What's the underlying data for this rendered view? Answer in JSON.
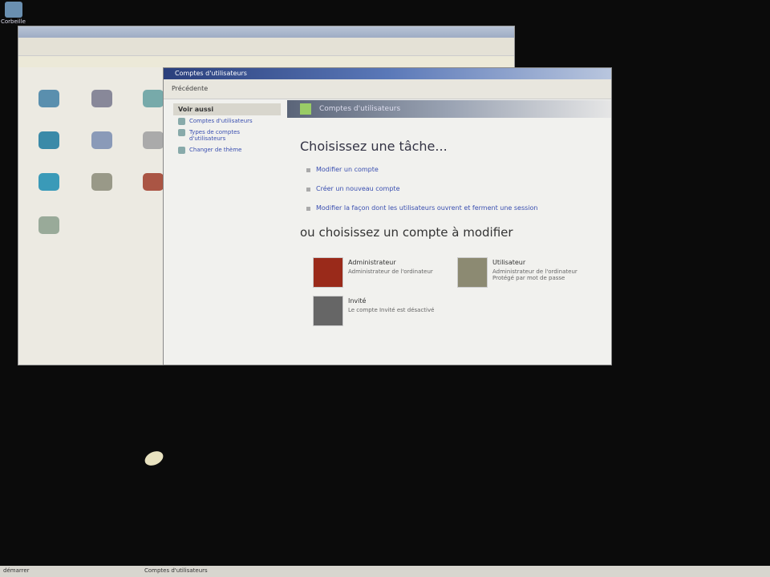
{
  "desktop": {
    "recycle_bin": "Corbeille"
  },
  "back_window": {
    "title": "Panneau de configuration"
  },
  "user_accounts": {
    "title": "Comptes d'utilisateurs",
    "toolbar": {
      "back": "Précédente"
    },
    "side": {
      "header": "Voir aussi",
      "items": [
        "Comptes d'utilisateurs",
        "Types de comptes d'utilisateurs",
        "Changer de thème"
      ]
    },
    "banner": "Comptes d'utilisateurs",
    "heading_task": "Choisissez une tâche...",
    "tasks": [
      "Modifier un compte",
      "Créer un nouveau compte",
      "Modifier la façon dont les utilisateurs ouvrent et ferment une session"
    ],
    "heading_account": "ou choisissez un compte à modifier",
    "accounts": [
      {
        "name": "Administrateur",
        "type": "Administrateur de l'ordinateur",
        "color": "#9a2a1a"
      },
      {
        "name": "Utilisateur",
        "type": "Administrateur de l'ordinateur Protégé par mot de passe",
        "color": "#8c8a72"
      },
      {
        "name": "Invité",
        "type": "Le compte Invité est désactivé",
        "color": "#666"
      }
    ]
  },
  "taskbar": {
    "start": "démarrer",
    "task": "Comptes d'utilisateurs"
  }
}
